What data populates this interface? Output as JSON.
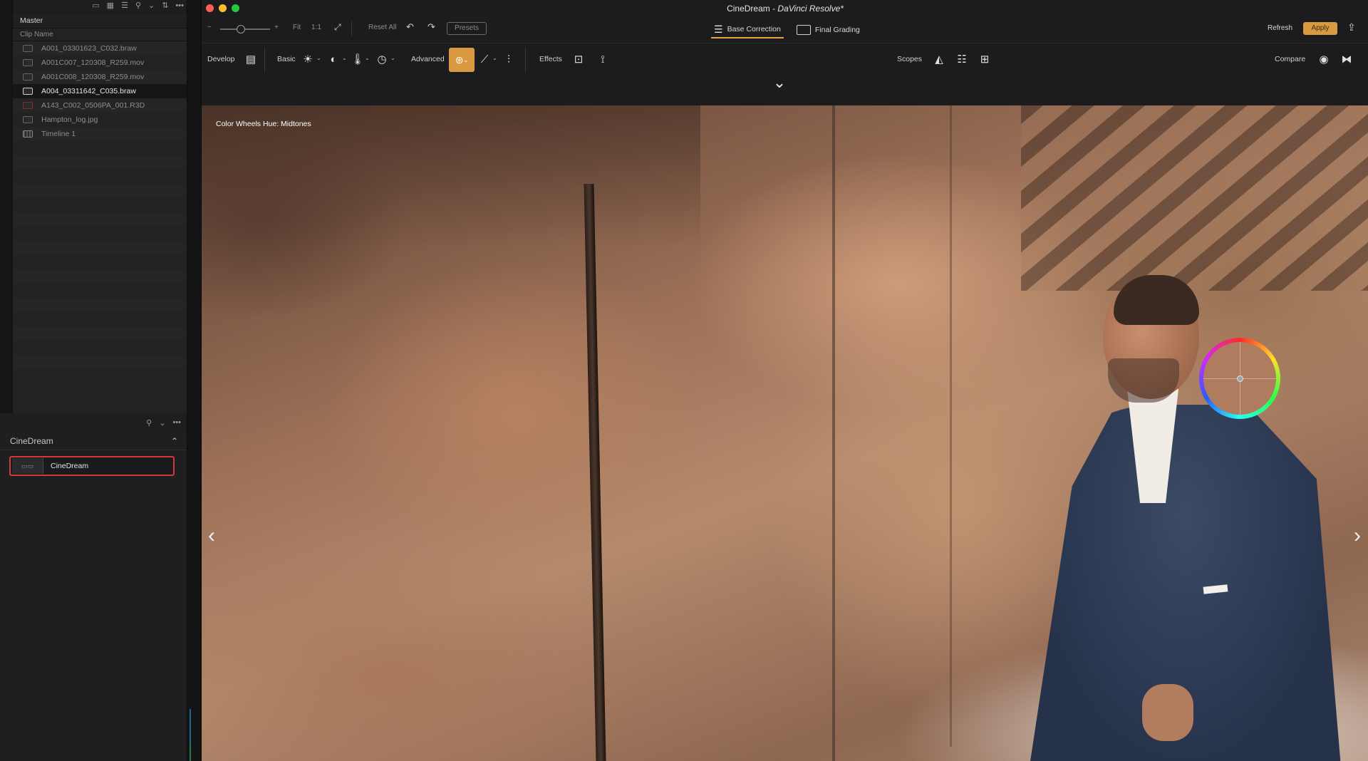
{
  "app": {
    "window_title_main": "CineDream",
    "window_title_sep": " - ",
    "window_title_app": "DaVinci Resolve*"
  },
  "media_pool": {
    "bin_name": "Master",
    "column_header": "Clip Name",
    "clips": [
      {
        "name": "A001_03301623_C032.braw",
        "icon": "video-clip-icon",
        "selected": false
      },
      {
        "name": "A001C007_120308_R259.mov",
        "icon": "video-clip-icon",
        "selected": false
      },
      {
        "name": "A001C008_120308_R259.mov",
        "icon": "video-clip-icon",
        "selected": false
      },
      {
        "name": "A004_03311642_C035.braw",
        "icon": "video-clip-icon",
        "selected": true
      },
      {
        "name": "A143_C002_0506PA_001.R3D",
        "icon": "red-clip-icon",
        "selected": false
      },
      {
        "name": "Hampton_log.jpg",
        "icon": "image-clip-icon",
        "selected": false
      },
      {
        "name": "Timeline 1",
        "icon": "timeline-icon",
        "selected": false
      }
    ]
  },
  "bins": {
    "title": "CineDream",
    "items": [
      {
        "label": "CineDream"
      }
    ]
  },
  "toolbar_top": {
    "fit": "Fit",
    "one_to_one": "1:1",
    "reset_all": "Reset All",
    "presets": "Presets",
    "zoom_level": 0.42
  },
  "view_tabs": [
    {
      "label": "Base Correction",
      "icon": "layers-icon",
      "active": true
    },
    {
      "label": "Final Grading",
      "icon": "image-icon",
      "active": false
    }
  ],
  "actions": {
    "refresh": "Refresh",
    "apply": "Apply"
  },
  "toolbar_tools": {
    "develop": "Develop",
    "basic": "Basic",
    "advanced": "Advanced",
    "effects": "Effects",
    "scopes": "Scopes",
    "compare": "Compare"
  },
  "viewer": {
    "caption": "Color Wheels Hue: Midtones"
  },
  "colors": {
    "accent": "#d99a3f",
    "selection_outline": "#d6373b",
    "close": "#fe5f57",
    "minimize": "#febc2e",
    "maximize": "#28c840"
  }
}
